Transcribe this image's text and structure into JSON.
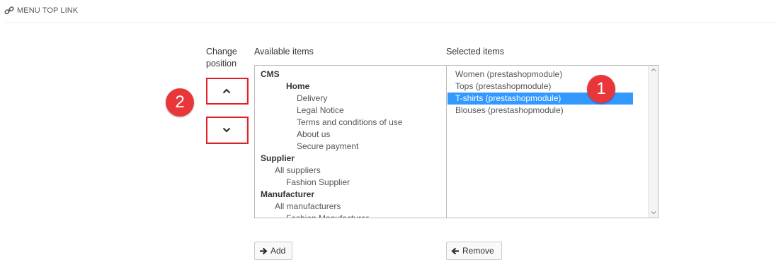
{
  "panel": {
    "title": "MENU TOP LINK",
    "icon": "link-icon"
  },
  "labels": {
    "change_position_line1": "Change",
    "change_position_line2": "position",
    "available": "Available items",
    "selected": "Selected items"
  },
  "available_items": [
    {
      "text": "CMS",
      "level": 0,
      "group": true
    },
    {
      "text": "Home",
      "level": 2,
      "group": true
    },
    {
      "text": "Delivery",
      "level": 3,
      "group": false
    },
    {
      "text": "Legal Notice",
      "level": 3,
      "group": false
    },
    {
      "text": "Terms and conditions of use",
      "level": 3,
      "group": false
    },
    {
      "text": "About us",
      "level": 3,
      "group": false
    },
    {
      "text": "Secure payment",
      "level": 3,
      "group": false
    },
    {
      "text": "Supplier",
      "level": 0,
      "group": true
    },
    {
      "text": "All suppliers",
      "level": 1,
      "group": false
    },
    {
      "text": "Fashion Supplier",
      "level": 2,
      "group": false
    },
    {
      "text": "Manufacturer",
      "level": 0,
      "group": true
    },
    {
      "text": "All manufacturers",
      "level": 1,
      "group": false
    },
    {
      "text": "Fashion Manufacturer",
      "level": 2,
      "group": false
    }
  ],
  "selected_items": [
    {
      "text": "Women (prestashopmodule)",
      "selected": false
    },
    {
      "text": "Tops (prestashopmodule)",
      "selected": false
    },
    {
      "text": "T-shirts (prestashopmodule)",
      "selected": true
    },
    {
      "text": "Blouses (prestashopmodule)",
      "selected": false
    }
  ],
  "buttons": {
    "move_up_icon": "chevron-up-icon",
    "move_down_icon": "chevron-down-icon",
    "add": "Add",
    "remove": "Remove"
  },
  "callouts": {
    "one": "1",
    "two": "2"
  },
  "colors": {
    "highlight": "#3399ff",
    "callout": "#e8363b",
    "frame": "#e31e24"
  }
}
